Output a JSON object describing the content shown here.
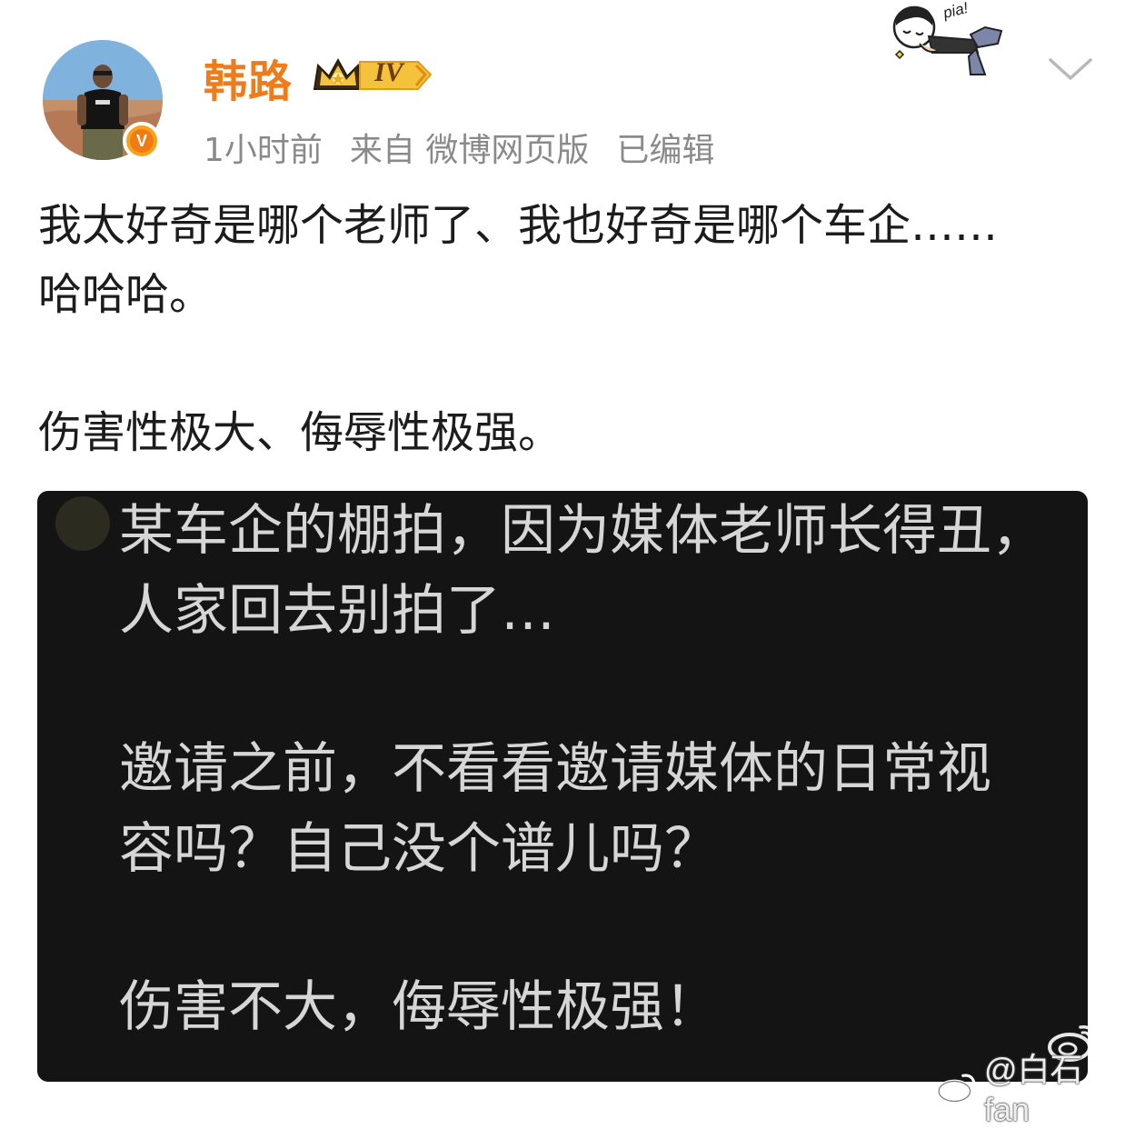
{
  "post": {
    "author": "韩路",
    "level": "IV",
    "verified_mark": "V",
    "time": "1小时前",
    "source": "来自 微博网页版",
    "edited": "已编辑",
    "text_lines": [
      "我太好奇是哪个老师了、我也好奇是哪个车企……",
      "哈哈哈。",
      "伤害性极大、侮辱性极强。"
    ]
  },
  "image": {
    "lines": [
      "某车企的棚拍，因为媒体老师长得丑，",
      "人家回去别拍了…",
      "邀请之前，不看看邀请媒体的日常视",
      "容吗？自己没个谱儿吗？",
      "伤害不大，侮辱性极强！"
    ],
    "watermark_at": "@"
  },
  "sticker": {
    "text": "pia!"
  },
  "watermark": {
    "handle": "@白石fan"
  },
  "icons": {
    "menu": "chevron-down-icon",
    "weibo": "weibo-logo-icon",
    "level": "crown-level-icon"
  },
  "colors": {
    "author": "#f07b1b",
    "meta": "#8a8a8a",
    "image_bg": "#141414",
    "image_text": "#d6d6d6",
    "verified": "#f7a21b"
  }
}
